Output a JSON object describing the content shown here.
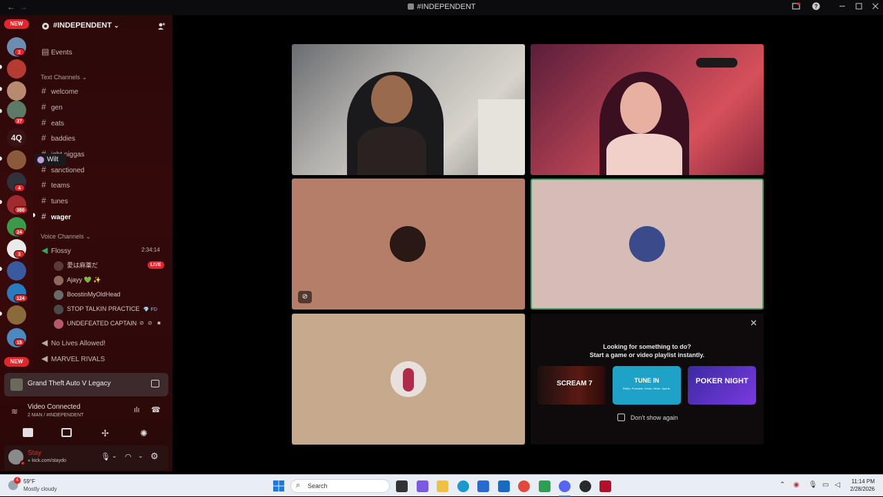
{
  "window": {
    "title": "#INDEPENDENT",
    "back_icon": "←",
    "forward_icon": "→"
  },
  "rail": {
    "top_badge": "NEW",
    "bottom_badge": "NEW",
    "four_q_label": "4Q",
    "badges": [
      "2",
      "37",
      "4",
      "380",
      "24",
      "3",
      "124",
      "15"
    ]
  },
  "server": {
    "name": "#INDEPENDENT",
    "events_label": "Events",
    "text_category": "Text Channels",
    "voice_category": "Voice Channels",
    "text_channels": [
      "welcome",
      "gen",
      "eats",
      "baddies",
      "ight niggas",
      "sanctioned",
      "teams",
      "tunes",
      "wager"
    ],
    "voice_channel_active": "Flossy",
    "voice_timer": "2:34:14",
    "voice_users": [
      {
        "name": "愛は麻薬だ",
        "badge": "LIVE"
      },
      {
        "name": "Ajayy 💚 ✨",
        "badge": ""
      },
      {
        "name": "BoostinMyOldHead",
        "badge": ""
      },
      {
        "name": "STOP TALKIN PRACTICE",
        "badge": "💎 FD"
      },
      {
        "name": "UNDEFEATED CAPTAIN",
        "badge": ""
      }
    ],
    "other_voice_channels": [
      "No Lives Allowed!",
      "MARVEL RIVALS"
    ]
  },
  "tooltip": {
    "text": "Wilt"
  },
  "game_bar": {
    "title": "Grand Theft Auto V Legacy"
  },
  "connection": {
    "status": "Video Connected",
    "channel": "2 MAN / #INDEPENDENT"
  },
  "user": {
    "name": "Stay",
    "status": "kick.com/staydo"
  },
  "activity": {
    "line1": "Looking for something to do?",
    "line2": "Start a game or video playlist instantly.",
    "cards": [
      "SCREAM 7",
      "TUNE IN",
      "POKER NIGHT"
    ],
    "cards_sub": [
      "",
      "Radio, Podcasts, Music, News, Sports.",
      "NIGHT"
    ],
    "checkbox_label": "Don't show again"
  },
  "taskbar": {
    "weather_temp": "59°F",
    "weather_desc": "Mostly cloudy",
    "weather_badge": "4",
    "search_label": "Search",
    "time": "11:14 PM",
    "date": "2/28/2026"
  },
  "colors": {
    "sidebar_bg": "#2c0909",
    "rail_bg": "#2a0809",
    "accent_red": "#e2262a",
    "speaking_green": "#3ba55d",
    "tile_brown": "#b47e68",
    "tile_pink": "#d6bcb6",
    "tile_tan": "#c7a98d"
  }
}
